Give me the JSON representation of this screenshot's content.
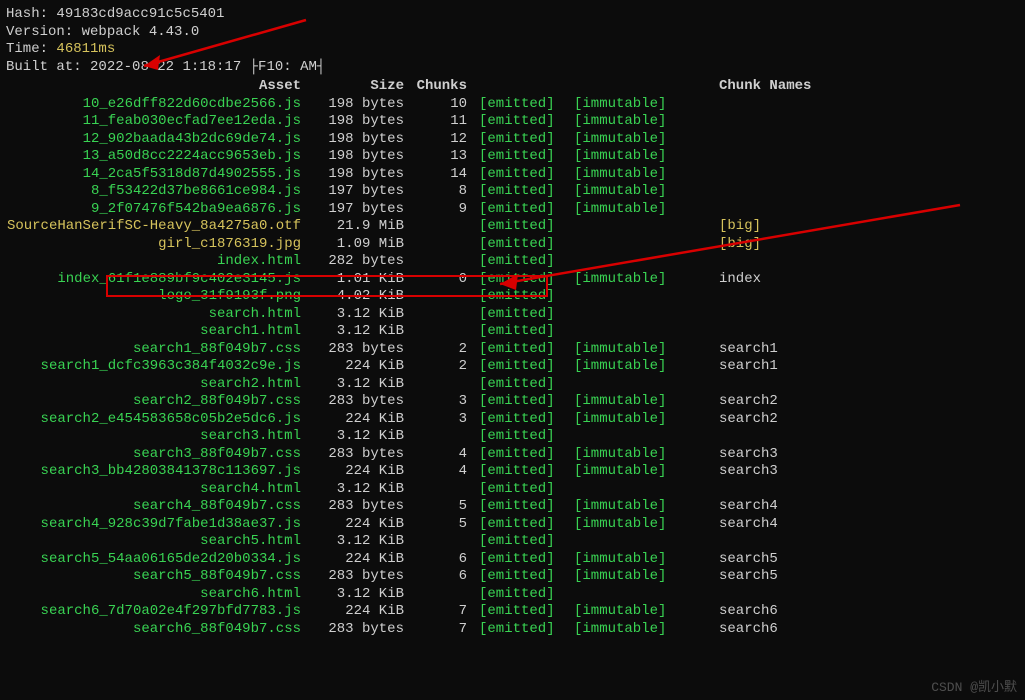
{
  "info": {
    "hashLabel": "Hash:",
    "hash": "49183cd9acc91c5c5401",
    "versionLabel": "Version:",
    "version": "webpack 4.43.0",
    "timeLabel": "Time:",
    "time": "46811ms",
    "builtLabel": "Built at:",
    "builtAt": "2022-08-22 1:18:17 ├F10: AM┤"
  },
  "table": {
    "head": {
      "asset": "Asset",
      "size": "Size",
      "chunks": "Chunks",
      "names": "Chunk Names"
    },
    "rows": [
      {
        "asset": "10_e26dff822d60cdbe2566.js",
        "ac": "g",
        "size": "198 bytes",
        "chunk": "10",
        "emit": "[emitted]",
        "imm": "[immutable]",
        "name": ""
      },
      {
        "asset": "11_feab030ecfad7ee12eda.js",
        "ac": "g",
        "size": "198 bytes",
        "chunk": "11",
        "emit": "[emitted]",
        "imm": "[immutable]",
        "name": ""
      },
      {
        "asset": "12_902baada43b2dc69de74.js",
        "ac": "g",
        "size": "198 bytes",
        "chunk": "12",
        "emit": "[emitted]",
        "imm": "[immutable]",
        "name": ""
      },
      {
        "asset": "13_a50d8cc2224acc9653eb.js",
        "ac": "g",
        "size": "198 bytes",
        "chunk": "13",
        "emit": "[emitted]",
        "imm": "[immutable]",
        "name": ""
      },
      {
        "asset": "14_2ca5f5318d87d4902555.js",
        "ac": "g",
        "size": "198 bytes",
        "chunk": "14",
        "emit": "[emitted]",
        "imm": "[immutable]",
        "name": ""
      },
      {
        "asset": "8_f53422d37be8661ce984.js",
        "ac": "g",
        "size": "197 bytes",
        "chunk": "8",
        "emit": "[emitted]",
        "imm": "[immutable]",
        "name": ""
      },
      {
        "asset": "9_2f07476f542ba9ea6876.js",
        "ac": "g",
        "size": "197 bytes",
        "chunk": "9",
        "emit": "[emitted]",
        "imm": "[immutable]",
        "name": ""
      },
      {
        "asset": "SourceHanSerifSC-Heavy_8a4275a0.otf",
        "ac": "y",
        "size": "21.9 MiB",
        "chunk": "",
        "emit": "[emitted]",
        "imm": "",
        "name": "[big]",
        "nc": "y"
      },
      {
        "asset": "girl_c1876319.jpg",
        "ac": "y",
        "size": "1.09 MiB",
        "chunk": "",
        "emit": "[emitted]",
        "imm": "",
        "name": "[big]",
        "nc": "y"
      },
      {
        "asset": "index.html",
        "ac": "g",
        "size": "282 bytes",
        "chunk": "",
        "emit": "[emitted]",
        "imm": "",
        "name": ""
      },
      {
        "asset": "index_61f1e889bf9c402e3145.js",
        "ac": "g",
        "size": "1.01 KiB",
        "chunk": "0",
        "emit": "[emitted]",
        "imm": "[immutable]",
        "name": "index"
      },
      {
        "asset": "logo_31f9193f.png",
        "ac": "g",
        "size": "4.02 KiB",
        "chunk": "",
        "emit": "[emitted]",
        "imm": "",
        "name": ""
      },
      {
        "asset": "search.html",
        "ac": "g",
        "size": "3.12 KiB",
        "chunk": "",
        "emit": "[emitted]",
        "imm": "",
        "name": ""
      },
      {
        "asset": "search1.html",
        "ac": "g",
        "size": "3.12 KiB",
        "chunk": "",
        "emit": "[emitted]",
        "imm": "",
        "name": ""
      },
      {
        "asset": "search1_88f049b7.css",
        "ac": "g",
        "size": "283 bytes",
        "chunk": "2",
        "emit": "[emitted]",
        "imm": "[immutable]",
        "name": "search1"
      },
      {
        "asset": "search1_dcfc3963c384f4032c9e.js",
        "ac": "g",
        "size": "224 KiB",
        "chunk": "2",
        "emit": "[emitted]",
        "imm": "[immutable]",
        "name": "search1"
      },
      {
        "asset": "search2.html",
        "ac": "g",
        "size": "3.12 KiB",
        "chunk": "",
        "emit": "[emitted]",
        "imm": "",
        "name": ""
      },
      {
        "asset": "search2_88f049b7.css",
        "ac": "g",
        "size": "283 bytes",
        "chunk": "3",
        "emit": "[emitted]",
        "imm": "[immutable]",
        "name": "search2"
      },
      {
        "asset": "search2_e454583658c05b2e5dc6.js",
        "ac": "g",
        "size": "224 KiB",
        "chunk": "3",
        "emit": "[emitted]",
        "imm": "[immutable]",
        "name": "search2"
      },
      {
        "asset": "search3.html",
        "ac": "g",
        "size": "3.12 KiB",
        "chunk": "",
        "emit": "[emitted]",
        "imm": "",
        "name": ""
      },
      {
        "asset": "search3_88f049b7.css",
        "ac": "g",
        "size": "283 bytes",
        "chunk": "4",
        "emit": "[emitted]",
        "imm": "[immutable]",
        "name": "search3"
      },
      {
        "asset": "search3_bb42803841378c113697.js",
        "ac": "g",
        "size": "224 KiB",
        "chunk": "4",
        "emit": "[emitted]",
        "imm": "[immutable]",
        "name": "search3"
      },
      {
        "asset": "search4.html",
        "ac": "g",
        "size": "3.12 KiB",
        "chunk": "",
        "emit": "[emitted]",
        "imm": "",
        "name": ""
      },
      {
        "asset": "search4_88f049b7.css",
        "ac": "g",
        "size": "283 bytes",
        "chunk": "5",
        "emit": "[emitted]",
        "imm": "[immutable]",
        "name": "search4"
      },
      {
        "asset": "search4_928c39d7fabe1d38ae37.js",
        "ac": "g",
        "size": "224 KiB",
        "chunk": "5",
        "emit": "[emitted]",
        "imm": "[immutable]",
        "name": "search4"
      },
      {
        "asset": "search5.html",
        "ac": "g",
        "size": "3.12 KiB",
        "chunk": "",
        "emit": "[emitted]",
        "imm": "",
        "name": ""
      },
      {
        "asset": "search5_54aa06165de2d20b0334.js",
        "ac": "g",
        "size": "224 KiB",
        "chunk": "6",
        "emit": "[emitted]",
        "imm": "[immutable]",
        "name": "search5"
      },
      {
        "asset": "search5_88f049b7.css",
        "ac": "g",
        "size": "283 bytes",
        "chunk": "6",
        "emit": "[emitted]",
        "imm": "[immutable]",
        "name": "search5"
      },
      {
        "asset": "search6.html",
        "ac": "g",
        "size": "3.12 KiB",
        "chunk": "",
        "emit": "[emitted]",
        "imm": "",
        "name": ""
      },
      {
        "asset": "search6_7d70a02e4f297bfd7783.js",
        "ac": "g",
        "size": "224 KiB",
        "chunk": "7",
        "emit": "[emitted]",
        "imm": "[immutable]",
        "name": "search6"
      },
      {
        "asset": "search6_88f049b7.css",
        "ac": "g",
        "size": "283 bytes",
        "chunk": "7",
        "emit": "[emitted]",
        "imm": "[immutable]",
        "name": "search6"
      }
    ]
  },
  "watermark": "CSDN @凯小默"
}
